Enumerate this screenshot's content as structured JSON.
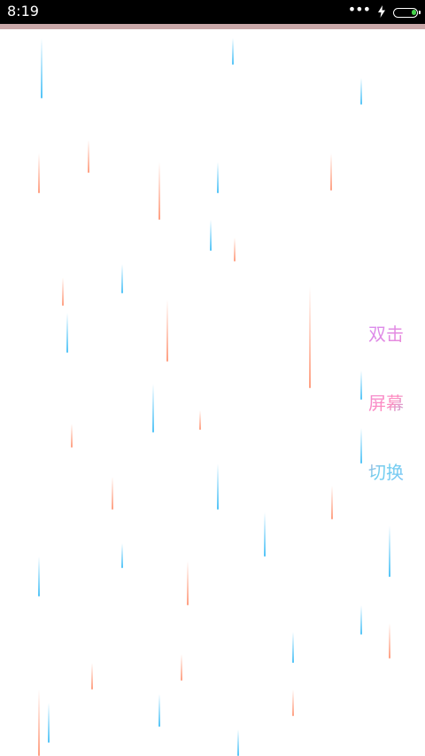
{
  "status_bar": {
    "time": "8:19",
    "icons": [
      "more-dots-icon",
      "charging-bolt-icon",
      "battery-icon"
    ],
    "battery_fill_color": "#46d34b"
  },
  "accent_bar_color": "#c9a7a8",
  "rain": {
    "colors": [
      "#4fc3f7",
      "#ff9e80"
    ]
  },
  "hint": {
    "lines": [
      "双击",
      "屏幕",
      "切换"
    ]
  }
}
